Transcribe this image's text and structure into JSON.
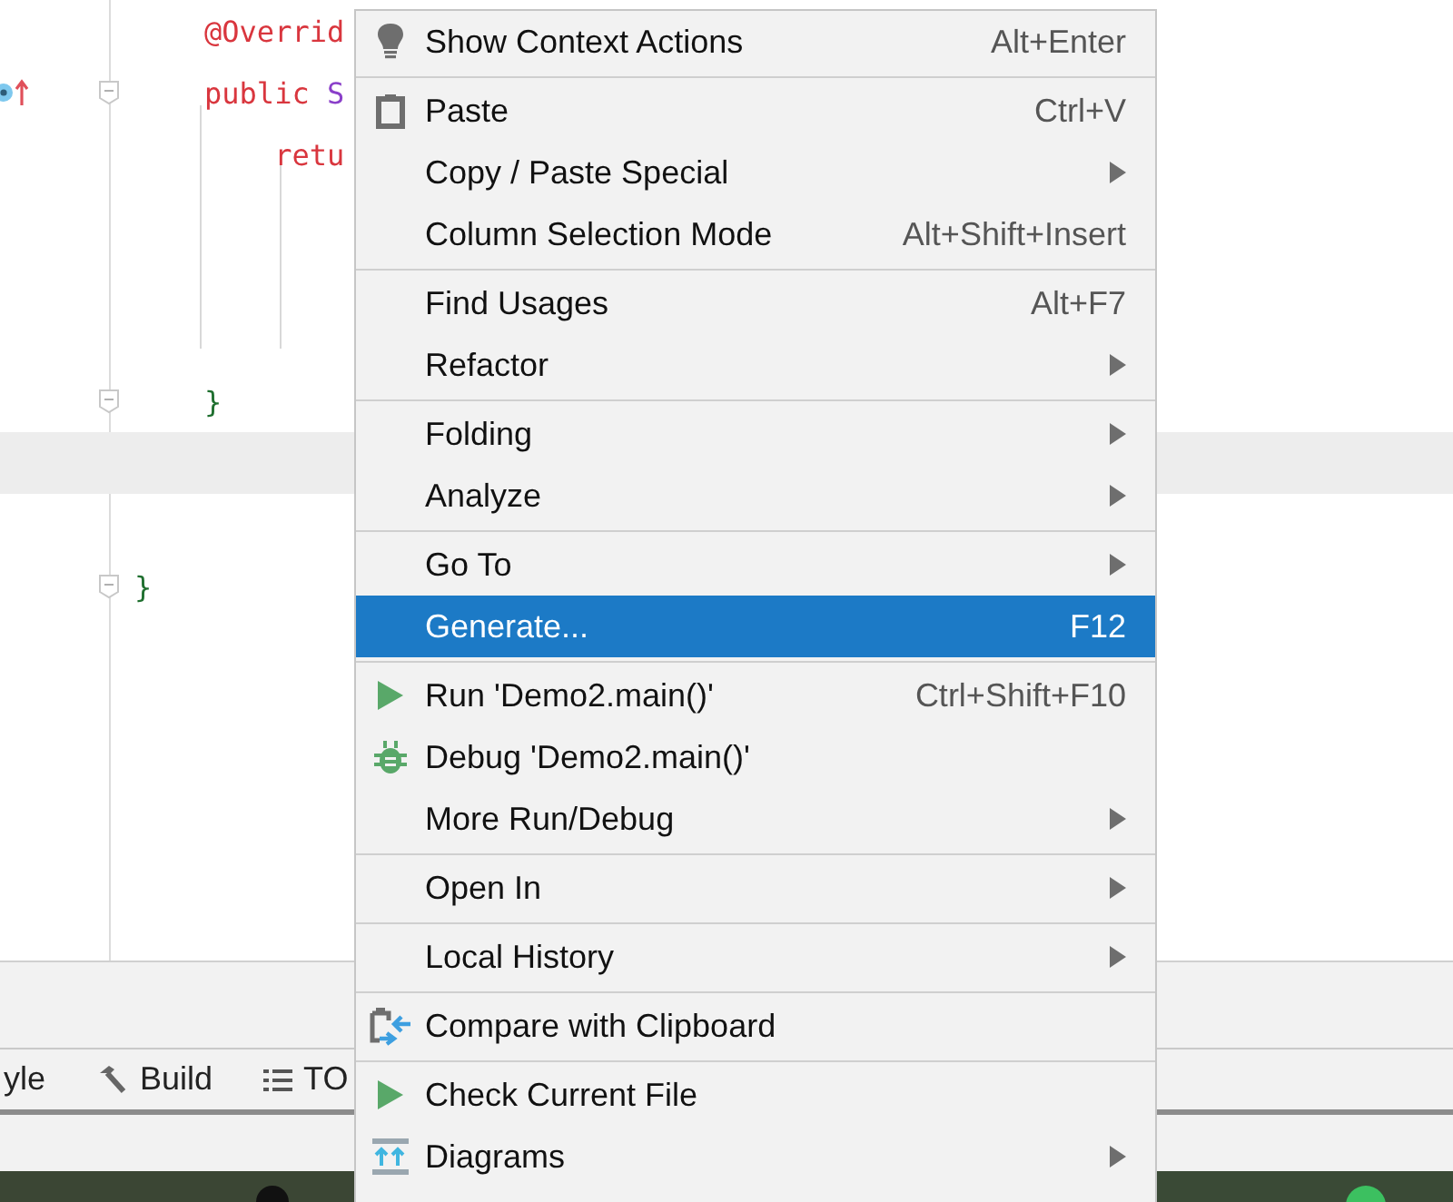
{
  "editor": {
    "lines": [
      {
        "tokens": [
          {
            "text": "    @Overrid",
            "kind": "annotation"
          }
        ],
        "fold": false,
        "current": false,
        "gutter_mark": false
      },
      {
        "tokens": [
          {
            "text": "    public ",
            "kind": "keyword"
          },
          {
            "text": "S",
            "kind": "type"
          }
        ],
        "fold": true,
        "current": false,
        "gutter_mark": true
      },
      {
        "tokens": [
          {
            "text": "        retu",
            "kind": "keyword"
          }
        ],
        "fold": false,
        "current": false,
        "gutter_mark": false
      },
      {
        "fold": false,
        "current": false,
        "gutter_mark": false
      },
      {
        "fold": false,
        "current": false,
        "gutter_mark": false
      },
      {
        "fold": false,
        "current": false,
        "gutter_mark": false
      },
      {
        "tokens": [
          {
            "text": "    }",
            "kind": "brace"
          }
        ],
        "fold": true,
        "current": false,
        "gutter_mark": false
      },
      {
        "fold": false,
        "current": true,
        "gutter_mark": false
      },
      {
        "fold": false,
        "current": false,
        "gutter_mark": false
      },
      {
        "tokens": [
          {
            "text": "}",
            "kind": "brace"
          }
        ],
        "fold": true,
        "current": false,
        "gutter_mark": false
      }
    ]
  },
  "tool_tabs": [
    {
      "label": "yle",
      "kind": "plain"
    },
    {
      "label": "Build",
      "kind": "hammer"
    },
    {
      "label": "TO",
      "kind": "list"
    }
  ],
  "context_menu": {
    "groups": [
      [
        {
          "label": "Show Context Actions",
          "shortcut": "Alt+Enter",
          "kind": "bulb",
          "submenu": false,
          "selected": false
        }
      ],
      [
        {
          "label": "Paste",
          "shortcut": "Ctrl+V",
          "kind": "clipboard",
          "submenu": false,
          "selected": false
        },
        {
          "label": "Copy / Paste Special",
          "kind": "none",
          "submenu": true,
          "selected": false
        },
        {
          "label": "Column Selection Mode",
          "shortcut": "Alt+Shift+Insert",
          "kind": "none",
          "submenu": false,
          "selected": false
        }
      ],
      [
        {
          "label": "Find Usages",
          "shortcut": "Alt+F7",
          "kind": "none",
          "submenu": false,
          "selected": false
        },
        {
          "label": "Refactor",
          "kind": "none",
          "submenu": true,
          "selected": false
        }
      ],
      [
        {
          "label": "Folding",
          "kind": "none",
          "submenu": true,
          "selected": false
        },
        {
          "label": "Analyze",
          "kind": "none",
          "submenu": true,
          "selected": false
        }
      ],
      [
        {
          "label": "Go To",
          "kind": "none",
          "submenu": true,
          "selected": false
        },
        {
          "label": "Generate...",
          "shortcut": "F12",
          "kind": "none",
          "submenu": false,
          "selected": true
        }
      ],
      [
        {
          "label": "Run 'Demo2.main()'",
          "shortcut": "Ctrl+Shift+F10",
          "kind": "run",
          "submenu": false,
          "selected": false
        },
        {
          "label": "Debug 'Demo2.main()'",
          "kind": "bug",
          "submenu": false,
          "selected": false
        },
        {
          "label": "More Run/Debug",
          "kind": "none",
          "submenu": true,
          "selected": false
        }
      ],
      [
        {
          "label": "Open In",
          "kind": "none",
          "submenu": true,
          "selected": false
        }
      ],
      [
        {
          "label": "Local History",
          "kind": "none",
          "submenu": true,
          "selected": false
        }
      ],
      [
        {
          "label": "Compare with Clipboard",
          "kind": "compare",
          "submenu": false,
          "selected": false
        }
      ],
      [
        {
          "label": "Check Current File",
          "kind": "run",
          "submenu": false,
          "selected": false
        },
        {
          "label": "Diagrams",
          "kind": "diagram",
          "submenu": true,
          "selected": false
        }
      ]
    ]
  }
}
